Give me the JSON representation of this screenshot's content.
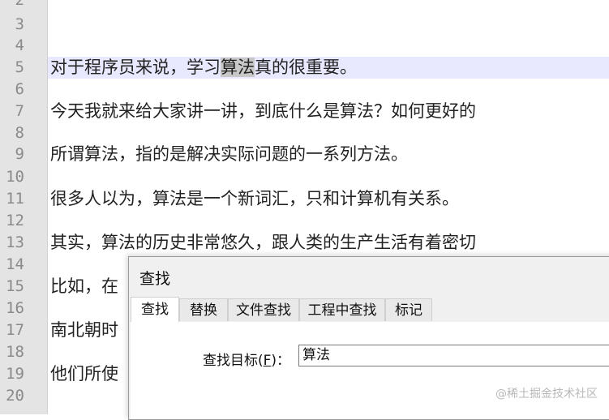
{
  "gutter": {
    "line_numbers": [
      "2",
      "3",
      "4",
      "5",
      "6",
      "7",
      "8",
      "9",
      "10",
      "11",
      "12",
      "13",
      "14",
      "15",
      "16",
      "17",
      "18",
      "19",
      "20"
    ]
  },
  "editor": {
    "lines": [
      {
        "no": "5",
        "pre": "对于程序员来说，学习",
        "hl": "算法",
        "post": "真的很重要。"
      },
      {
        "no": "7",
        "text": "今天我就来给大家讲一讲，到底什么是算法？如何更好的"
      },
      {
        "no": "9",
        "text": "所谓算法，指的是解决实际问题的一系列方法。"
      },
      {
        "no": "11",
        "text": "很多人以为，算法是一个新词汇，只和计算机有关系。"
      },
      {
        "no": "13",
        "text": "其实，算法的历史非常悠久，跟人类的生产生活有着密切"
      },
      {
        "no": "15",
        "text": "比如，在"
      },
      {
        "no": "17",
        "text": "南北朝时"
      },
      {
        "no": "19",
        "text": "他们所使"
      }
    ]
  },
  "find_dialog": {
    "title": "查找",
    "tabs": [
      "查找",
      "替换",
      "文件查找",
      "工程中查找",
      "标记"
    ],
    "target_label_pre": "查找目标(",
    "target_label_key": "F",
    "target_label_post": ")：",
    "target_value": "算法"
  },
  "watermark": "@稀土掘金技术社区"
}
